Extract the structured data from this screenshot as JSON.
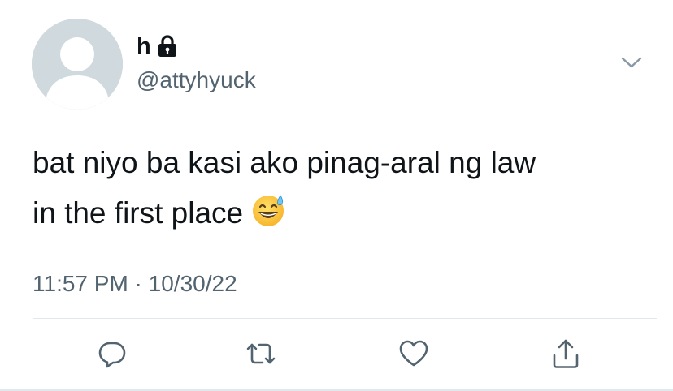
{
  "tweet": {
    "display_name": "h",
    "handle": "@attyhyuck",
    "text_line1": "bat niyo ba kasi ako pinag-aral ng law",
    "text_line2": "in the first place",
    "emoji": "grinning-face-with-sweat",
    "timestamp": "11:57 PM · 10/30/22",
    "protected": true
  },
  "actions": {
    "reply_icon": "reply-icon",
    "retweet_icon": "retweet-icon",
    "like_icon": "heart-icon",
    "share_icon": "share-icon"
  },
  "colors": {
    "text": "#0f1419",
    "secondary": "#536471",
    "avatar_bg": "#cfd9de",
    "divider": "#e1e8ed"
  }
}
